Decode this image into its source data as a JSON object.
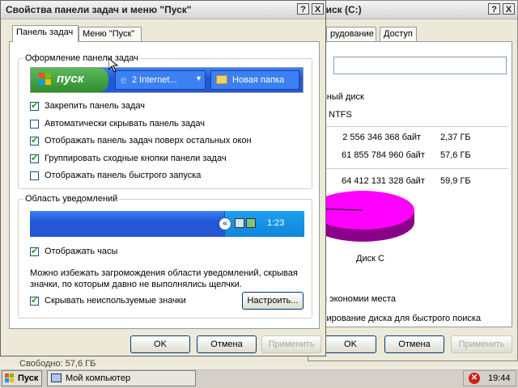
{
  "back_window": {
    "title": "диск (C:)",
    "tabs": [
      "рудование",
      "Доступ"
    ],
    "type_text": "ьный диск",
    "fs_text": "NTFS",
    "used": {
      "bytes": "2 556 346 368 байт",
      "gb": "2,37 ГБ"
    },
    "free": {
      "bytes": "61 855 784 960 байт",
      "gb": "57,6 ГБ"
    },
    "total": {
      "bytes": "64 412 131 328 байт",
      "gb": "59,9 ГБ"
    },
    "disk_label": "Диск C",
    "compress_text": "я экономии места",
    "index_text": "сирование диска для быстрого поиска",
    "ok": "OK",
    "cancel": "Отмена",
    "apply": "Применить",
    "colors": {
      "free": "#ff00ff",
      "used": "#0000ff"
    }
  },
  "front_window": {
    "title": "Свойства панели задач и меню \"Пуск\"",
    "help_btn": "?",
    "close_btn": "X",
    "tabs": [
      "Панель задач",
      "Меню \"Пуск\""
    ],
    "group1_title": "Оформление панели задач",
    "preview": {
      "start": "пуск",
      "task1": "2 Internet...",
      "task2": "Новая папка"
    },
    "options": [
      {
        "label": "Закрепить панель задач",
        "checked": true
      },
      {
        "label": "Автоматически скрывать панель задач",
        "checked": false
      },
      {
        "label": "Отображать панель задач поверх остальных окон",
        "checked": true
      },
      {
        "label": "Группировать сходные кнопки панели задач",
        "checked": true
      },
      {
        "label": "Отображать панель быстрого запуска",
        "checked": false
      }
    ],
    "group2_title": "Область уведомлений",
    "tray_clock": "1:23",
    "show_clock": {
      "label": "Отображать часы",
      "checked": true
    },
    "hint": "Можно избежать загромождения области уведомлений, скрывая значки, по которым давно не выполнялись щелчки.",
    "hide_icons": {
      "label": "Скрывать неиспользуемые значки",
      "checked": true
    },
    "customize": "Настроить...",
    "ok": "OK",
    "cancel": "Отмена",
    "apply": "Применить"
  },
  "behind_text": "Свободно: 57,6 ГБ",
  "taskbar": {
    "start": "Пуск",
    "item": "Мой компьютер",
    "clock": "19:44"
  }
}
